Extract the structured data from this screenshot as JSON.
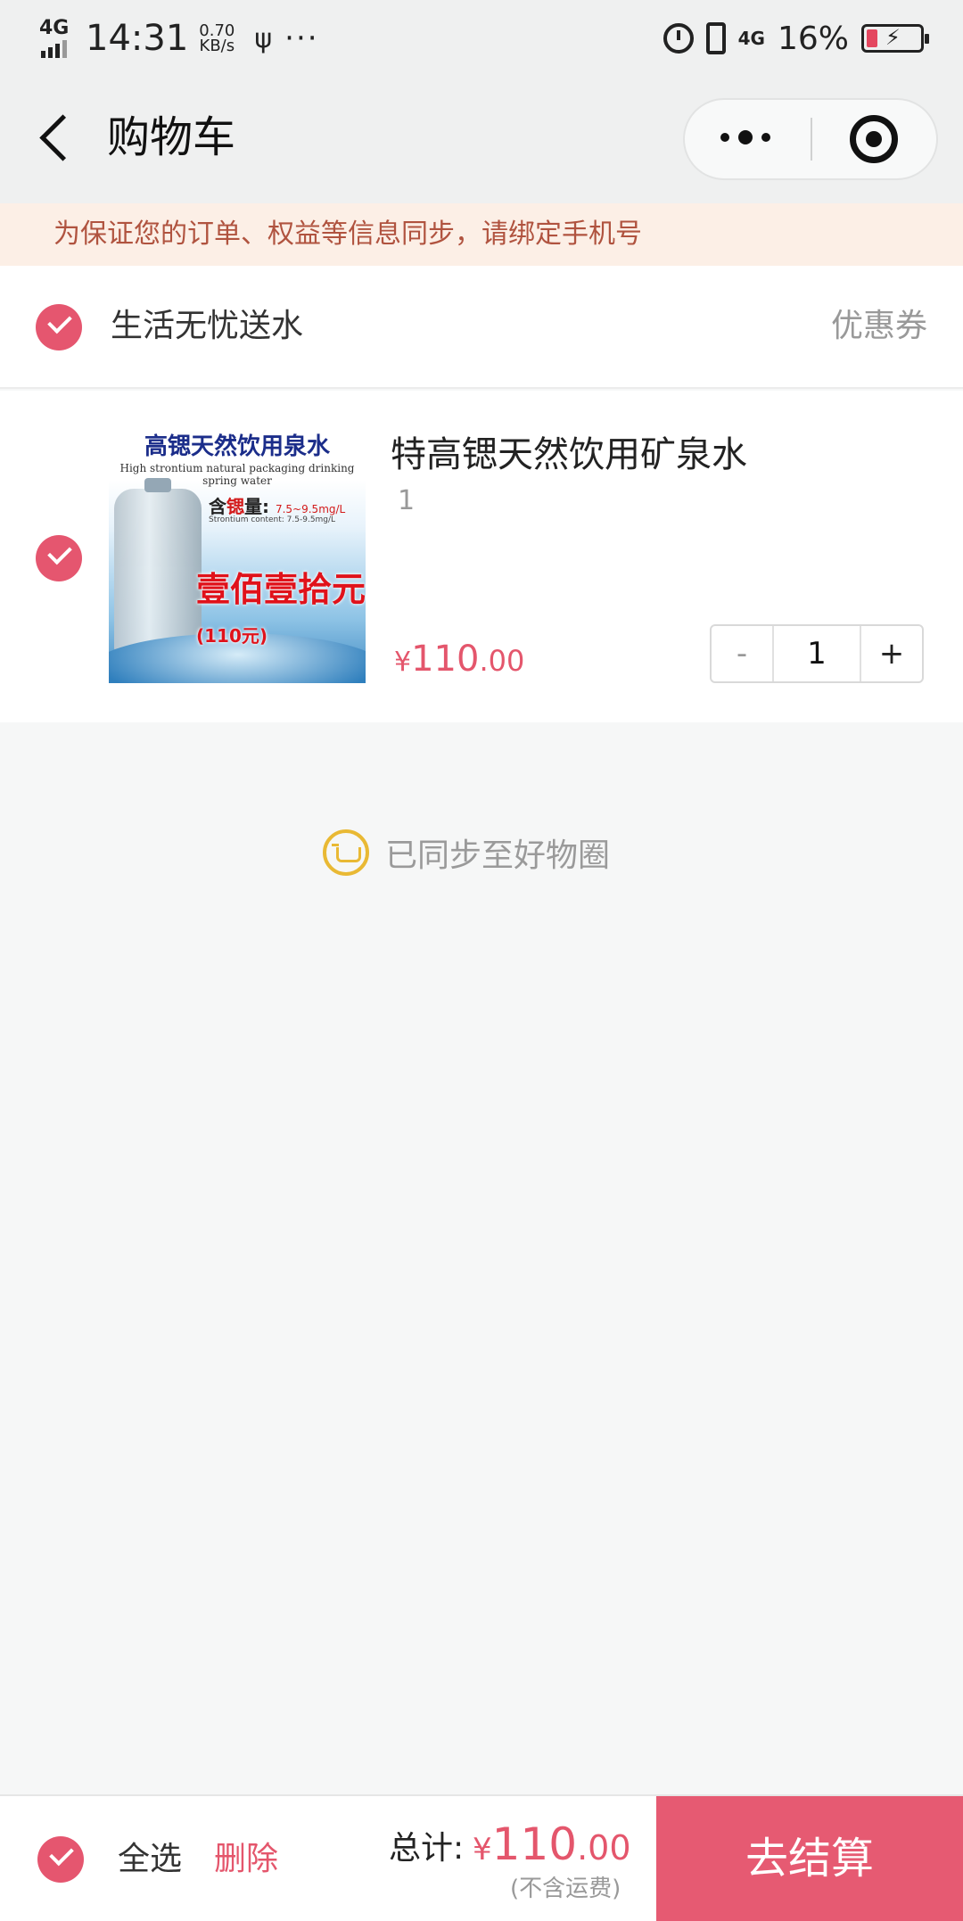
{
  "status_bar": {
    "network": "4G",
    "time": "14:31",
    "speed_value": "0.70",
    "speed_unit": "KB/s",
    "usb_icon": "usb-icon",
    "more": "···",
    "right_network": "4G",
    "battery_percent": "16%",
    "battery_level": 0.16
  },
  "nav": {
    "title": "购物车",
    "back_icon": "chevron-left-icon",
    "more_icon": "more-dots-icon",
    "close_icon": "target-close-icon"
  },
  "notice": {
    "text": "为保证您的订单、权益等信息同步，请绑定手机号"
  },
  "store": {
    "name": "生活无忧送水",
    "coupon_label": "优惠券",
    "checked": true
  },
  "product": {
    "title": "特高锶天然饮用矿泉水",
    "spec": "1",
    "price_currency": "¥",
    "price_int": "110",
    "price_dec": ".00",
    "quantity": "1",
    "minus_label": "-",
    "plus_label": "+",
    "checked": true,
    "image": {
      "headline": "高锶天然饮用泉水",
      "subtitle": "High strontium natural packaging drinking spring water",
      "content_label": "含",
      "content_label_mid": "锶",
      "content_label_end": "量:",
      "content_value": "7.5~9.5mg/L",
      "content_en": "Strontium content: 7.5-9.5mg/L",
      "price_big": "壹佰壹拾元",
      "price_small": "(110元)"
    }
  },
  "sync": {
    "text": "已同步至好物圈",
    "icon": "cart-circle-icon"
  },
  "bottom": {
    "select_all_label": "全选",
    "delete_label": "删除",
    "total_label": "总计:",
    "total_currency": "¥",
    "total_int": "110",
    "total_dec": ".00",
    "total_note": "(不含运费)",
    "checkout_label": "去结算"
  },
  "colors": {
    "accent": "#e5566f",
    "notice_bg": "#fcefe6",
    "notice_text": "#b0533f",
    "sync_icon": "#e9b934"
  }
}
